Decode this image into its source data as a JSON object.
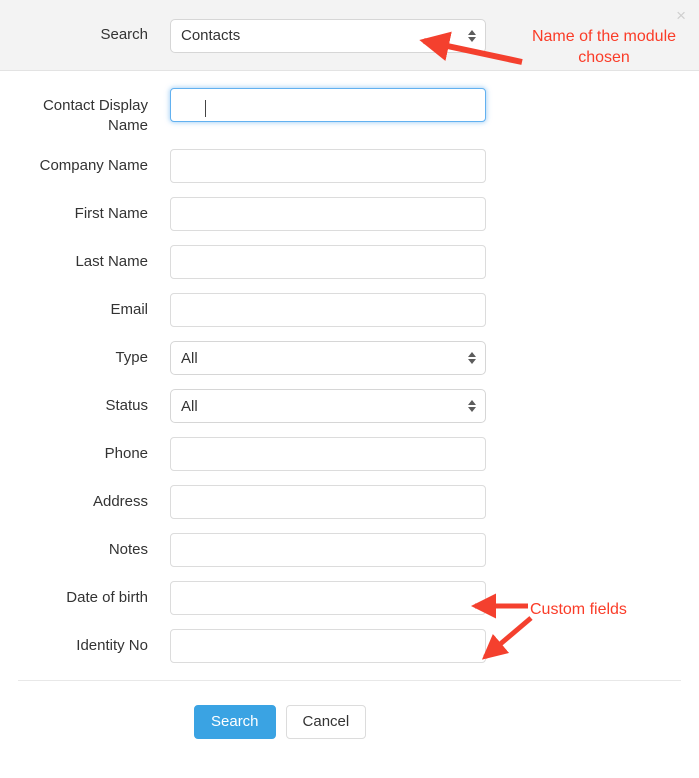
{
  "dialog": {
    "close_icon": "close-icon",
    "close_label": "×"
  },
  "header": {
    "label": "Search",
    "module_select": {
      "value": "Contacts",
      "options": [
        "Contacts"
      ]
    }
  },
  "form": {
    "rows": [
      {
        "label": "Contact Display Name",
        "type": "text",
        "value": "",
        "placeholder": "",
        "focused": true
      },
      {
        "label": "Company Name",
        "type": "text",
        "value": "",
        "placeholder": "",
        "focused": false
      },
      {
        "label": "First Name",
        "type": "text",
        "value": "",
        "placeholder": "",
        "focused": false
      },
      {
        "label": "Last Name",
        "type": "text",
        "value": "",
        "placeholder": "",
        "focused": false
      },
      {
        "label": "Email",
        "type": "text",
        "value": "",
        "placeholder": "",
        "focused": false
      },
      {
        "label": "Type",
        "type": "select",
        "value": "All",
        "options": [
          "All"
        ],
        "focused": false
      },
      {
        "label": "Status",
        "type": "select",
        "value": "All",
        "options": [
          "All"
        ],
        "focused": false
      },
      {
        "label": "Phone",
        "type": "text",
        "value": "",
        "placeholder": "",
        "focused": false
      },
      {
        "label": "Address",
        "type": "text",
        "value": "",
        "placeholder": "",
        "focused": false
      },
      {
        "label": "Notes",
        "type": "text",
        "value": "",
        "placeholder": "",
        "focused": false
      },
      {
        "label": "Date of birth",
        "type": "text",
        "value": "",
        "placeholder": "",
        "focused": false
      },
      {
        "label": "Identity No",
        "type": "text",
        "value": "",
        "placeholder": "",
        "focused": false
      }
    ]
  },
  "footer": {
    "search_label": "Search",
    "cancel_label": "Cancel"
  },
  "annotations": {
    "module": "Name of the module\nchosen",
    "custom_fields": "Custom fields",
    "color": "#fa3c28"
  },
  "colors": {
    "primary_button": "#3aa3e3",
    "annotation_red": "#fa3c28",
    "header_background": "#f3f3f3",
    "focus_blue": "#62b1f0"
  }
}
